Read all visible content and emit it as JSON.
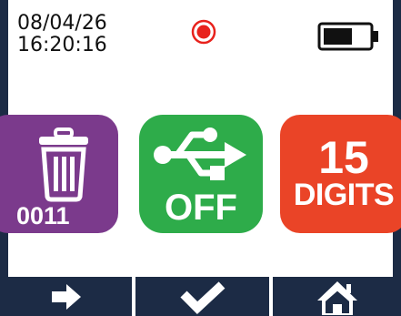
{
  "status": {
    "date": "08/04/26",
    "time": "16:20:16",
    "record_icon": "record-indicator-icon",
    "battery_icon": "battery-icon",
    "battery_level": 0.65
  },
  "tiles": {
    "trash": {
      "icon": "trash-icon",
      "label": "0011",
      "color": "#7b3a8c"
    },
    "usb": {
      "icon": "usb-icon",
      "label": "OFF",
      "color": "#2eac4a"
    },
    "digits": {
      "number": "15",
      "label": "DIGITS",
      "color": "#ea4427"
    }
  },
  "softkeys": [
    {
      "icon": "arrow-right-icon"
    },
    {
      "icon": "checkmark-icon"
    },
    {
      "icon": "home-icon"
    }
  ],
  "colors": {
    "bezel": "#1c2b45",
    "record": "#e8221c"
  }
}
